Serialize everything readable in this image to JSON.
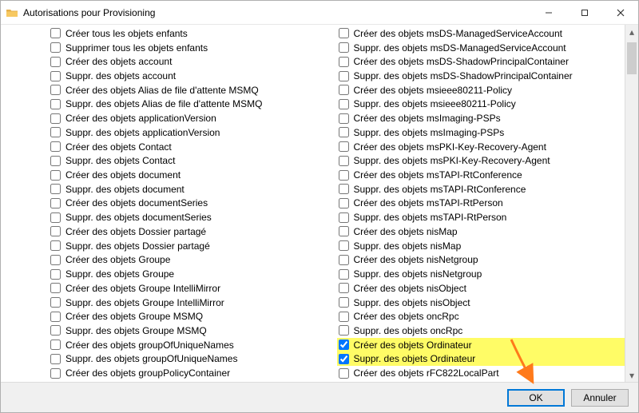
{
  "window": {
    "title": "Autorisations pour Provisioning"
  },
  "buttons": {
    "ok": "OK",
    "cancel": "Annuler"
  },
  "columns": {
    "left": [
      {
        "label": "Créer tous les objets enfants",
        "checked": false,
        "hl": false
      },
      {
        "label": "Supprimer tous les objets enfants",
        "checked": false,
        "hl": false
      },
      {
        "label": "Créer des objets account",
        "checked": false,
        "hl": false
      },
      {
        "label": "Suppr. des objets account",
        "checked": false,
        "hl": false
      },
      {
        "label": "Créer des objets Alias de file d'attente MSMQ",
        "checked": false,
        "hl": false
      },
      {
        "label": "Suppr. des objets Alias de file d'attente MSMQ",
        "checked": false,
        "hl": false
      },
      {
        "label": "Créer des objets applicationVersion",
        "checked": false,
        "hl": false
      },
      {
        "label": "Suppr. des objets applicationVersion",
        "checked": false,
        "hl": false
      },
      {
        "label": "Créer des objets Contact",
        "checked": false,
        "hl": false
      },
      {
        "label": "Suppr. des objets Contact",
        "checked": false,
        "hl": false
      },
      {
        "label": "Créer des objets document",
        "checked": false,
        "hl": false
      },
      {
        "label": "Suppr. des objets document",
        "checked": false,
        "hl": false
      },
      {
        "label": "Créer des objets documentSeries",
        "checked": false,
        "hl": false
      },
      {
        "label": "Suppr. des objets documentSeries",
        "checked": false,
        "hl": false
      },
      {
        "label": "Créer des objets Dossier partagé",
        "checked": false,
        "hl": false
      },
      {
        "label": "Suppr. des objets Dossier partagé",
        "checked": false,
        "hl": false
      },
      {
        "label": "Créer des objets Groupe",
        "checked": false,
        "hl": false
      },
      {
        "label": "Suppr. des objets Groupe",
        "checked": false,
        "hl": false
      },
      {
        "label": "Créer des objets Groupe IntelliMirror",
        "checked": false,
        "hl": false
      },
      {
        "label": "Suppr. des objets Groupe IntelliMirror",
        "checked": false,
        "hl": false
      },
      {
        "label": "Créer des objets Groupe MSMQ",
        "checked": false,
        "hl": false
      },
      {
        "label": "Suppr. des objets Groupe MSMQ",
        "checked": false,
        "hl": false
      },
      {
        "label": "Créer des objets groupOfUniqueNames",
        "checked": false,
        "hl": false
      },
      {
        "label": "Suppr. des objets groupOfUniqueNames",
        "checked": false,
        "hl": false
      },
      {
        "label": "Créer des objets groupPolicyContainer",
        "checked": false,
        "hl": false
      }
    ],
    "right": [
      {
        "label": "Créer des objets msDS-ManagedServiceAccount",
        "checked": false,
        "hl": false
      },
      {
        "label": "Suppr. des objets msDS-ManagedServiceAccount",
        "checked": false,
        "hl": false
      },
      {
        "label": "Créer des objets msDS-ShadowPrincipalContainer",
        "checked": false,
        "hl": false
      },
      {
        "label": "Suppr. des objets msDS-ShadowPrincipalContainer",
        "checked": false,
        "hl": false
      },
      {
        "label": "Créer des objets msieee80211-Policy",
        "checked": false,
        "hl": false
      },
      {
        "label": "Suppr. des objets msieee80211-Policy",
        "checked": false,
        "hl": false
      },
      {
        "label": "Créer des objets msImaging-PSPs",
        "checked": false,
        "hl": false
      },
      {
        "label": "Suppr. des objets msImaging-PSPs",
        "checked": false,
        "hl": false
      },
      {
        "label": "Créer des objets msPKI-Key-Recovery-Agent",
        "checked": false,
        "hl": false
      },
      {
        "label": "Suppr. des objets msPKI-Key-Recovery-Agent",
        "checked": false,
        "hl": false
      },
      {
        "label": "Créer des objets msTAPI-RtConference",
        "checked": false,
        "hl": false
      },
      {
        "label": "Suppr. des objets msTAPI-RtConference",
        "checked": false,
        "hl": false
      },
      {
        "label": "Créer des objets msTAPI-RtPerson",
        "checked": false,
        "hl": false
      },
      {
        "label": "Suppr. des objets msTAPI-RtPerson",
        "checked": false,
        "hl": false
      },
      {
        "label": "Créer des objets nisMap",
        "checked": false,
        "hl": false
      },
      {
        "label": "Suppr. des objets nisMap",
        "checked": false,
        "hl": false
      },
      {
        "label": "Créer des objets nisNetgroup",
        "checked": false,
        "hl": false
      },
      {
        "label": "Suppr. des objets nisNetgroup",
        "checked": false,
        "hl": false
      },
      {
        "label": "Créer des objets nisObject",
        "checked": false,
        "hl": false
      },
      {
        "label": "Suppr. des objets nisObject",
        "checked": false,
        "hl": false
      },
      {
        "label": "Créer des objets oncRpc",
        "checked": false,
        "hl": false
      },
      {
        "label": "Suppr. des objets oncRpc",
        "checked": false,
        "hl": false
      },
      {
        "label": "Créer des objets Ordinateur",
        "checked": true,
        "hl": true
      },
      {
        "label": "Suppr. des objets Ordinateur",
        "checked": true,
        "hl": true
      },
      {
        "label": "Créer des objets rFC822LocalPart",
        "checked": false,
        "hl": false
      }
    ]
  }
}
